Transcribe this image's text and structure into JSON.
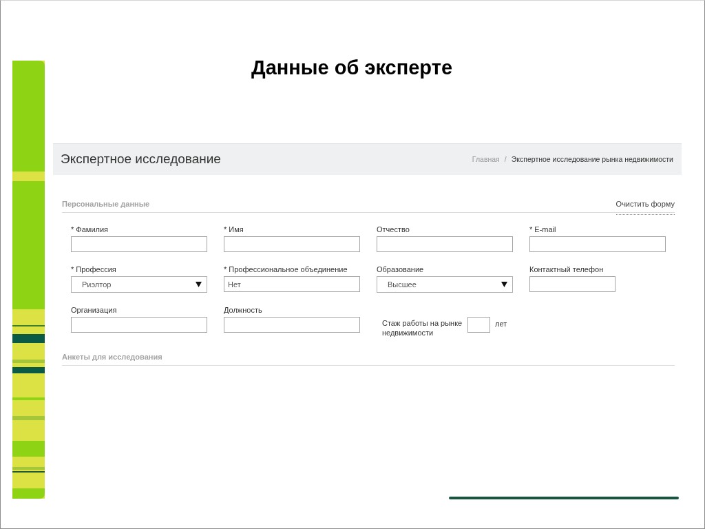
{
  "slide": {
    "title": "Данные об эксперте"
  },
  "page_header": {
    "title": "Экспертное исследование",
    "separator": "/",
    "breadcrumbs": [
      {
        "label": "Главная",
        "selected": false
      },
      {
        "label": "Экспертное исследование рынка недвижимости",
        "selected": true
      }
    ]
  },
  "sections": [
    {
      "title": "Персональные данные",
      "action": "Очистить форму",
      "fields": [
        {
          "kind": "text",
          "label": "* Фамилия"
        },
        {
          "kind": "text",
          "label": "* Имя"
        },
        {
          "kind": "text",
          "label": "Отчество"
        },
        {
          "kind": "text",
          "label": "* E-mail"
        },
        {
          "kind": "select",
          "label": "* Профессия",
          "value": "Риэлтор"
        },
        {
          "kind": "text",
          "label": "* Профессиональное объединение",
          "value": "Нет"
        },
        {
          "kind": "select",
          "label": "Образование",
          "value": "Высшее"
        },
        {
          "kind": "phone",
          "label": "Контактный телефон"
        },
        {
          "kind": "text",
          "label": "Организация"
        },
        {
          "kind": "text",
          "label": "Должность"
        },
        {
          "kind": "years",
          "label": "Стаж работы на рынке недвижимости",
          "suffix": "лет"
        }
      ]
    },
    {
      "title": "Анкеты для исследования"
    }
  ]
}
